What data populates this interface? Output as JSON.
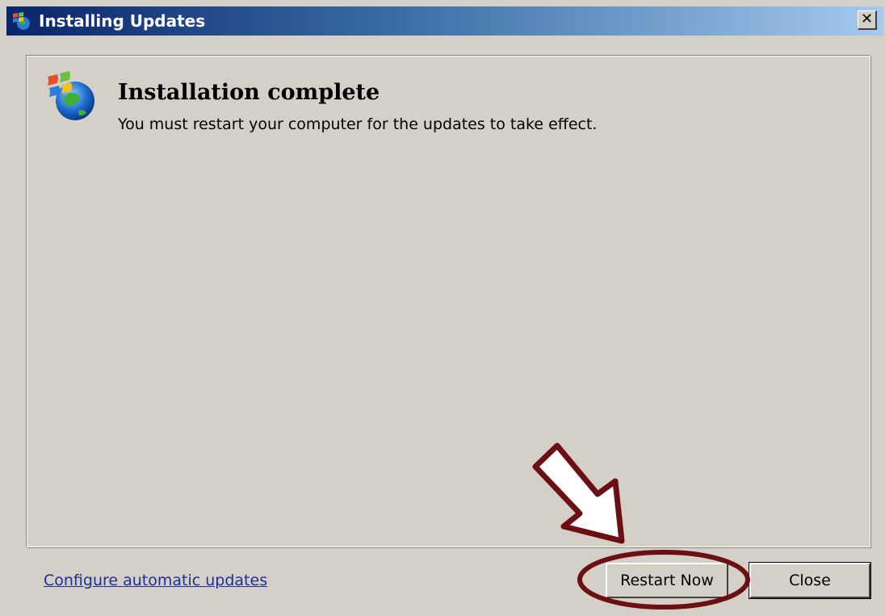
{
  "window": {
    "title": "Installing Updates",
    "close_glyph": "✕"
  },
  "content": {
    "heading": "Installation complete",
    "message": "You must restart your computer for the updates to take effect.",
    "icon": "windows-update-globe-icon"
  },
  "footer": {
    "configure_link": "Configure automatic updates",
    "restart_label": "Restart Now",
    "close_label": "Close"
  },
  "annotation": {
    "arrow_icon": "down-arrow-icon",
    "highlight_color": "#6b0f14"
  },
  "colors": {
    "titlebar_start": "#0a246a",
    "titlebar_end": "#a6caf0",
    "dialog_bg": "#d4d0c8",
    "link": "#1b2f9c"
  }
}
